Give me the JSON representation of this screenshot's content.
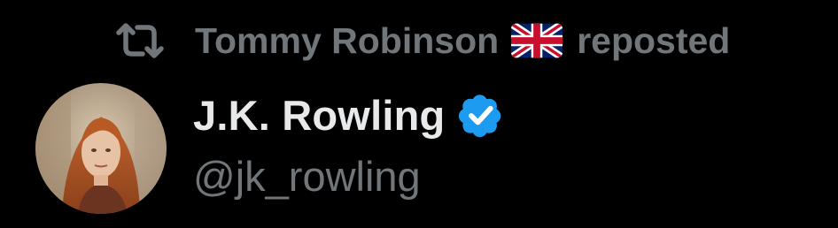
{
  "repost": {
    "icon": "repost-icon",
    "user_name": "Tommy Robinson",
    "flag_icon": "uk-flag-icon",
    "label": "reposted"
  },
  "author": {
    "display_name": "J.K. Rowling",
    "handle": "@jk_rowling",
    "verified_icon": "verified-badge-icon",
    "avatar_icon": "avatar-image"
  },
  "colors": {
    "background": "#000000",
    "primary_text": "#e7e9ea",
    "secondary_text": "#71767b",
    "verified_blue": "#1d9bf0"
  }
}
